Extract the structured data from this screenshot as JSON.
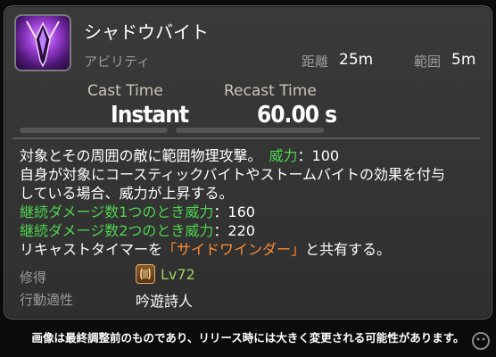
{
  "action": {
    "name": "シャドウバイト",
    "category": "アビリティ",
    "range_label": "距離",
    "range_value": "25m",
    "radius_label": "範囲",
    "radius_value": "5m",
    "icon": "shadowbite-action-icon"
  },
  "timing": {
    "cast_label": "Cast Time",
    "cast_value": "Instant",
    "recast_label": "Recast Time",
    "recast_value": "60.00 s"
  },
  "description": {
    "line1_text": "対象とその周囲の敵に範囲物理攻撃。　",
    "line1_potency_label": "威力",
    "line1_potency_value": "：100",
    "line2": "自身が対象にコースティックバイトやストームバイトの効果を付与",
    "line3": "している場合、威力が上昇する。",
    "line4_label": "継続ダメージ数1つのとき威力",
    "line4_value": "：160",
    "line5_label": "継続ダメージ数2つのとき威力",
    "line5_value": "：220",
    "line6_prefix": "リキャストタイマーを",
    "line6_link": "「サイドワインダー」",
    "line6_suffix": "と共有する。"
  },
  "acquisition": {
    "label": "修得",
    "level": "Lv72",
    "job_icon": "bard-job-icon",
    "affinity_label": "行動適性",
    "affinity_value": "吟遊詩人"
  },
  "footer": {
    "notice": "画像は最終調整前のものであり、リリース時には大きく変更される可能性があります。"
  },
  "colors": {
    "panel_bg": "#333333",
    "green": "#4fd24f",
    "orange": "#ff8a33",
    "level_green": "#9fd060"
  }
}
